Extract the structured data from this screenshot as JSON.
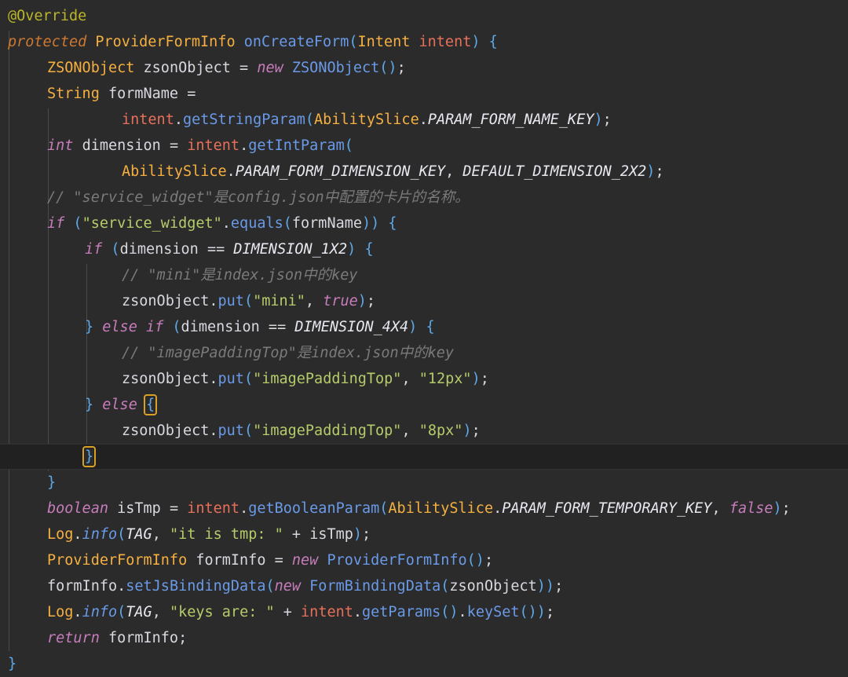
{
  "editor": {
    "language": "Java",
    "theme": "Darcula",
    "background_color": "#2b2b2b",
    "current_line_color": "#212121",
    "brace_match_outline_color": "#d8a024",
    "indent_guide_color": "#4b4b4b"
  },
  "colors": {
    "annotation": "#bbb529",
    "keyword": "#cc7832",
    "keyword_purple": "#c77dbb",
    "class_name": "#f5b041",
    "method": "#6a9ae8",
    "field": "#e8705b",
    "static_const": "#e8e8f0",
    "string": "#b5cc6a",
    "comment": "#7a7a7a",
    "plain": "#d8d8e0",
    "paren": "#5fa8e8"
  },
  "code": {
    "lines": [
      {
        "id": "l1",
        "indent": 0,
        "current": false,
        "text": "@Override"
      },
      {
        "id": "l2",
        "indent": 0,
        "current": false,
        "text": "protected ProviderFormInfo onCreateForm(Intent intent) {"
      },
      {
        "id": "l3",
        "indent": 1,
        "current": false,
        "text": "ZSONObject zsonObject = new ZSONObject();"
      },
      {
        "id": "l4",
        "indent": 1,
        "current": false,
        "text": "String formName ="
      },
      {
        "id": "l5",
        "indent": 2,
        "current": false,
        "text": "intent.getStringParam(AbilitySlice.PARAM_FORM_NAME_KEY);"
      },
      {
        "id": "l6",
        "indent": 1,
        "current": false,
        "text": "int dimension = intent.getIntParam("
      },
      {
        "id": "l7",
        "indent": 2,
        "current": false,
        "text": "AbilitySlice.PARAM_FORM_DIMENSION_KEY, DEFAULT_DIMENSION_2X2);"
      },
      {
        "id": "l8",
        "indent": 1,
        "current": false,
        "text": "// \"service_widget\"是config.json中配置的卡片的名称。"
      },
      {
        "id": "l9",
        "indent": 1,
        "current": false,
        "text": "if (\"service_widget\".equals(formName)) {"
      },
      {
        "id": "l10",
        "indent": 2,
        "current": false,
        "text": "if (dimension == DIMENSION_1X2) {"
      },
      {
        "id": "l11",
        "indent": 3,
        "current": false,
        "text": "// \"mini\"是index.json中的key"
      },
      {
        "id": "l12",
        "indent": 3,
        "current": false,
        "text": "zsonObject.put(\"mini\", true);"
      },
      {
        "id": "l13",
        "indent": 2,
        "current": false,
        "text": "} else if (dimension == DIMENSION_4X4) {"
      },
      {
        "id": "l14",
        "indent": 3,
        "current": false,
        "text": "// \"imagePaddingTop\"是index.json中的key"
      },
      {
        "id": "l15",
        "indent": 3,
        "current": false,
        "text": "zsonObject.put(\"imagePaddingTop\", \"12px\");"
      },
      {
        "id": "l16",
        "indent": 2,
        "current": false,
        "text": "} else {"
      },
      {
        "id": "l17",
        "indent": 3,
        "current": false,
        "text": "zsonObject.put(\"imagePaddingTop\", \"8px\");"
      },
      {
        "id": "l18",
        "indent": 2,
        "current": true,
        "text": "}"
      },
      {
        "id": "l19",
        "indent": 1,
        "current": false,
        "text": "}"
      },
      {
        "id": "l20",
        "indent": 1,
        "current": false,
        "text": "boolean isTmp = intent.getBooleanParam(AbilitySlice.PARAM_FORM_TEMPORARY_KEY, false);"
      },
      {
        "id": "l21",
        "indent": 1,
        "current": false,
        "text": "Log.info(TAG, \"it is tmp: \" + isTmp);"
      },
      {
        "id": "l22",
        "indent": 1,
        "current": false,
        "text": "ProviderFormInfo formInfo = new ProviderFormInfo();"
      },
      {
        "id": "l23",
        "indent": 1,
        "current": false,
        "text": "formInfo.setJsBindingData(new FormBindingData(zsonObject));"
      },
      {
        "id": "l24",
        "indent": 1,
        "current": false,
        "text": "Log.info(TAG, \"keys are: \" + intent.getParams().keySet());"
      },
      {
        "id": "l25",
        "indent": 1,
        "current": false,
        "text": "return formInfo;"
      },
      {
        "id": "l26",
        "indent": 0,
        "current": false,
        "text": "}"
      }
    ],
    "matched_braces": [
      "{ (on else line)",
      "} (on current line)"
    ],
    "comments": [
      "// \"service_widget\"是config.json中配置的卡片的名称。",
      "// \"mini\"是index.json中的key",
      "// \"imagePaddingTop\"是index.json中的key"
    ],
    "strings": [
      "service_widget",
      "mini",
      "imagePaddingTop",
      "12px",
      "8px",
      "it is tmp: ",
      "keys are: "
    ],
    "keywords": [
      "protected",
      "new",
      "int",
      "if",
      "else",
      "true",
      "false",
      "boolean",
      "return"
    ],
    "identifiers": {
      "method_name": "onCreateForm",
      "return_type": "ProviderFormInfo",
      "parameter": "intent",
      "parameter_type": "Intent",
      "locals": [
        "zsonObject",
        "formName",
        "dimension",
        "isTmp",
        "formInfo"
      ],
      "classes": [
        "ProviderFormInfo",
        "Intent",
        "ZSONObject",
        "String",
        "AbilitySlice",
        "Log",
        "FormBindingData"
      ],
      "constants": [
        "PARAM_FORM_NAME_KEY",
        "PARAM_FORM_DIMENSION_KEY",
        "DEFAULT_DIMENSION_2X2",
        "DIMENSION_1X2",
        "DIMENSION_4X4",
        "PARAM_FORM_TEMPORARY_KEY",
        "TAG"
      ],
      "methods": [
        "getStringParam",
        "getIntParam",
        "equals",
        "put",
        "getBooleanParam",
        "info",
        "setJsBindingData",
        "getParams",
        "keySet"
      ]
    }
  }
}
